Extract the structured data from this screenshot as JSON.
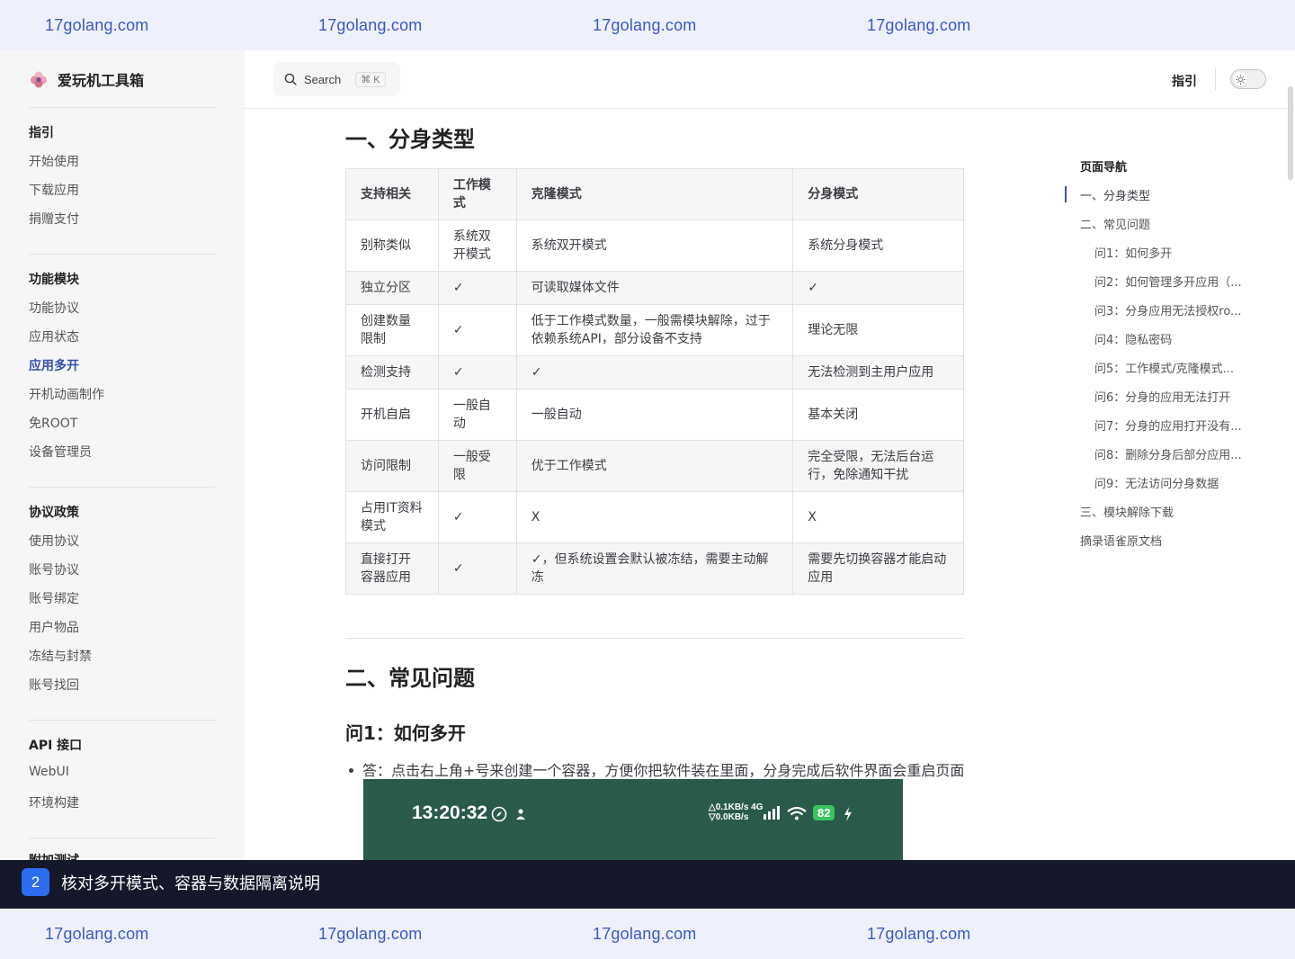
{
  "watermark": [
    "17golang.com",
    "17golang.com",
    "17golang.com",
    "17golang.com"
  ],
  "brand": {
    "title": "爱玩机工具箱",
    "logo_icon": "flower-logo-icon"
  },
  "sidebar": {
    "groups": [
      {
        "title": "指引",
        "items": [
          "开始使用",
          "下载应用",
          "捐赠支付"
        ]
      },
      {
        "title": "功能模块",
        "items": [
          "功能协议",
          "应用状态",
          "应用多开",
          "开机动画制作",
          "免ROOT",
          "设备管理员"
        ]
      },
      {
        "title": "协议政策",
        "items": [
          "使用协议",
          "账号协议",
          "账号绑定",
          "用户物品",
          "冻结与封禁",
          "账号找回"
        ]
      },
      {
        "title": "API 接口",
        "items": [
          "WebUI",
          "环境构建"
        ]
      },
      {
        "title": "附加测试",
        "items": []
      }
    ],
    "active_item": "应用多开"
  },
  "topbar": {
    "search_label": "Search",
    "search_kbd": "⌘ K",
    "nav_guide": "指引",
    "theme_toggle_icon": "sun-icon"
  },
  "main": {
    "section1_title": "一、分身类型",
    "table": {
      "headers": [
        "支持相关",
        "工作模式",
        "克隆模式",
        "分身模式"
      ],
      "rows": [
        [
          "别称类似",
          "系统双开模式",
          "系统双开模式",
          "系统分身模式"
        ],
        [
          "独立分区",
          "✓",
          "可读取媒体文件",
          "✓"
        ],
        [
          "创建数量限制",
          "✓",
          "低于工作模式数量，一般需模块解除，过于依赖系统API，部分设备不支持",
          "理论无限"
        ],
        [
          "检测支持",
          "✓",
          "✓",
          "无法检测到主用户应用"
        ],
        [
          "开机自启",
          "一般自动",
          "一般自动",
          "基本关闭"
        ],
        [
          "访问限制",
          "一般受限",
          "优于工作模式",
          "完全受限，无法后台运行，免除通知干扰"
        ],
        [
          "占用IT资料模式",
          "✓",
          "X",
          "X"
        ],
        [
          "直接打开容器应用",
          "✓",
          "✓，但系统设置会默认被冻结，需要主动解冻",
          "需要先切换容器才能启动应用"
        ]
      ]
    },
    "section2_title": "二、常见问题",
    "q1_title": "问1：如何多开",
    "q1_answer": "答：点击右上角+号来创建一个容器，方便你把软件装在里面，分身完成后软件界面会重启页面",
    "phone": {
      "time": "13:20:32",
      "net_up": "△0.1KB/s 4G",
      "net_down": "▽0.0KB/s",
      "battery": "82"
    }
  },
  "aside": {
    "title": "页面导航",
    "items": [
      {
        "label": "一、分身类型",
        "level": 1
      },
      {
        "label": "二、常见问题",
        "level": 1
      },
      {
        "label": "问1：如何多开",
        "level": 2
      },
      {
        "label": "问2：如何管理多开应用（...",
        "level": 2
      },
      {
        "label": "问3：分身应用无法授权ro...",
        "level": 2
      },
      {
        "label": "问4：隐私密码",
        "level": 2
      },
      {
        "label": "问5：工作模式/克隆模式...",
        "level": 2
      },
      {
        "label": "问6：分身的应用无法打开",
        "level": 2
      },
      {
        "label": "问7：分身的应用打开没有...",
        "level": 2
      },
      {
        "label": "问8：删除分身后部分应用...",
        "level": 2
      },
      {
        "label": "问9：无法访问分身数据",
        "level": 2
      },
      {
        "label": "三、模块解除下载",
        "level": 1
      },
      {
        "label": "摘录语雀原文档",
        "level": 1
      }
    ]
  },
  "caption": {
    "badge": "2",
    "text": "核对多开模式、容器与数据隔离说明"
  }
}
